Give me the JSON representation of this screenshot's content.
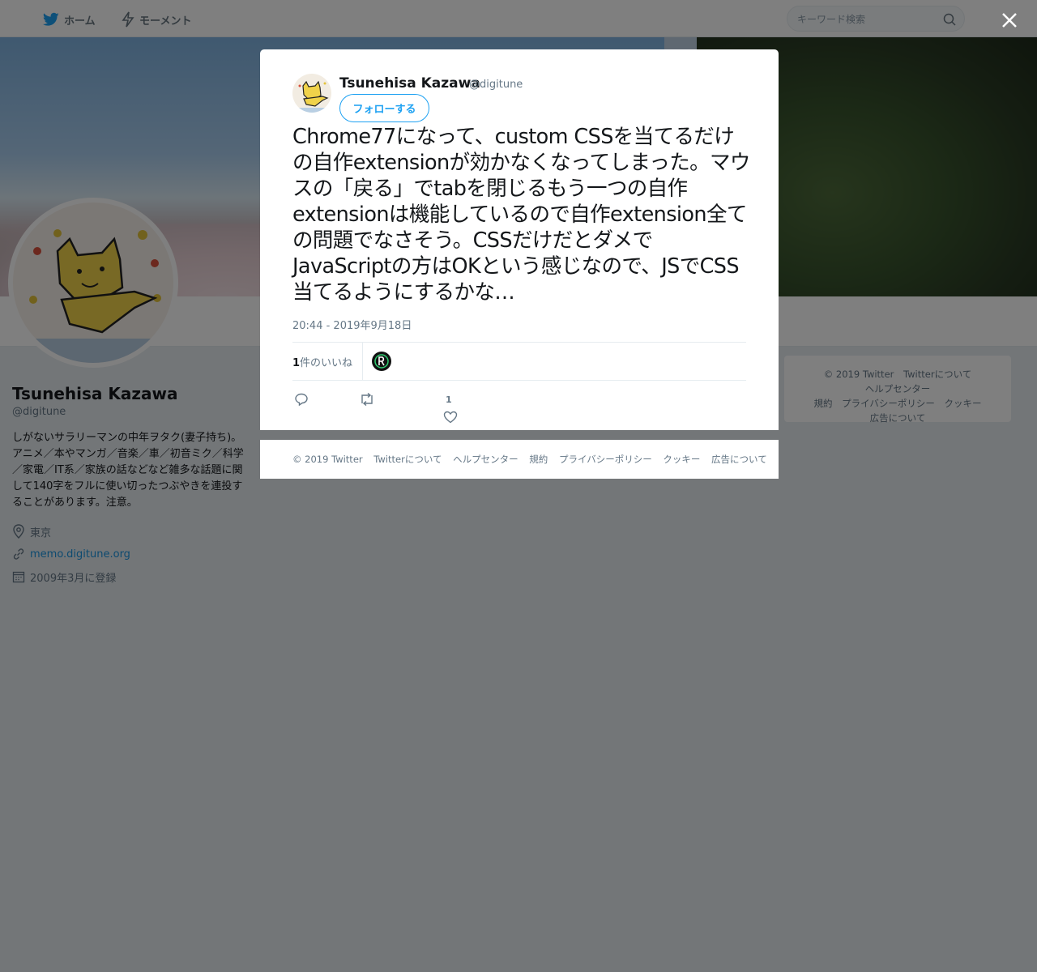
{
  "nav": {
    "home_label": "ホーム",
    "moments_label": "モーメント",
    "search_placeholder": "キーワード検索"
  },
  "profile": {
    "name": "Tsunehisa Kazawa",
    "handle": "@digitune",
    "bio": "しがないサラリーマンの中年ヲタク(妻子持ち)。アニメ／本やマンガ／音楽／車／初音ミク／科学／家電／IT系／家族の話などなど雑多な話題に関して140字をフルに使い切ったつぶやきを連投することがあります。注意。",
    "location": "東京",
    "url": "memo.digitune.org",
    "joined": "2009年3月に登録"
  },
  "side_footer": {
    "links": [
      "© 2019 Twitter",
      "Twitterについて",
      "ヘルプセンター",
      "規約",
      "プライバシーポリシー",
      "クッキー",
      "広告について"
    ]
  },
  "tweet": {
    "author_name": "Tsunehisa Kazawa",
    "author_handle": "@digitune",
    "follow_label": "フォローする",
    "text": "Chrome77になって、custom CSSを当てるだけの自作extensionが効かなくなってしまった。マウスの「戻る」でtabを閉じるもう一つの自作extensionは機能しているので自作extension全ての問題でなさそう。CSSだけだとダメでJavaScriptの方はOKという感じなので、JSでCSS当てるようにするかな…",
    "timestamp": "20:44 - 2019年9月18日",
    "likes_number": "1",
    "likes_suffix": "件のいいね",
    "like_action_count": "1"
  },
  "modal_footer": {
    "links": [
      "© 2019 Twitter",
      "Twitterについて",
      "ヘルプセンター",
      "規約",
      "プライバシーポリシー",
      "クッキー",
      "広告について"
    ]
  },
  "colors": {
    "accent": "#1da1f2",
    "text_secondary": "#657786",
    "link": "#1b95e0"
  }
}
